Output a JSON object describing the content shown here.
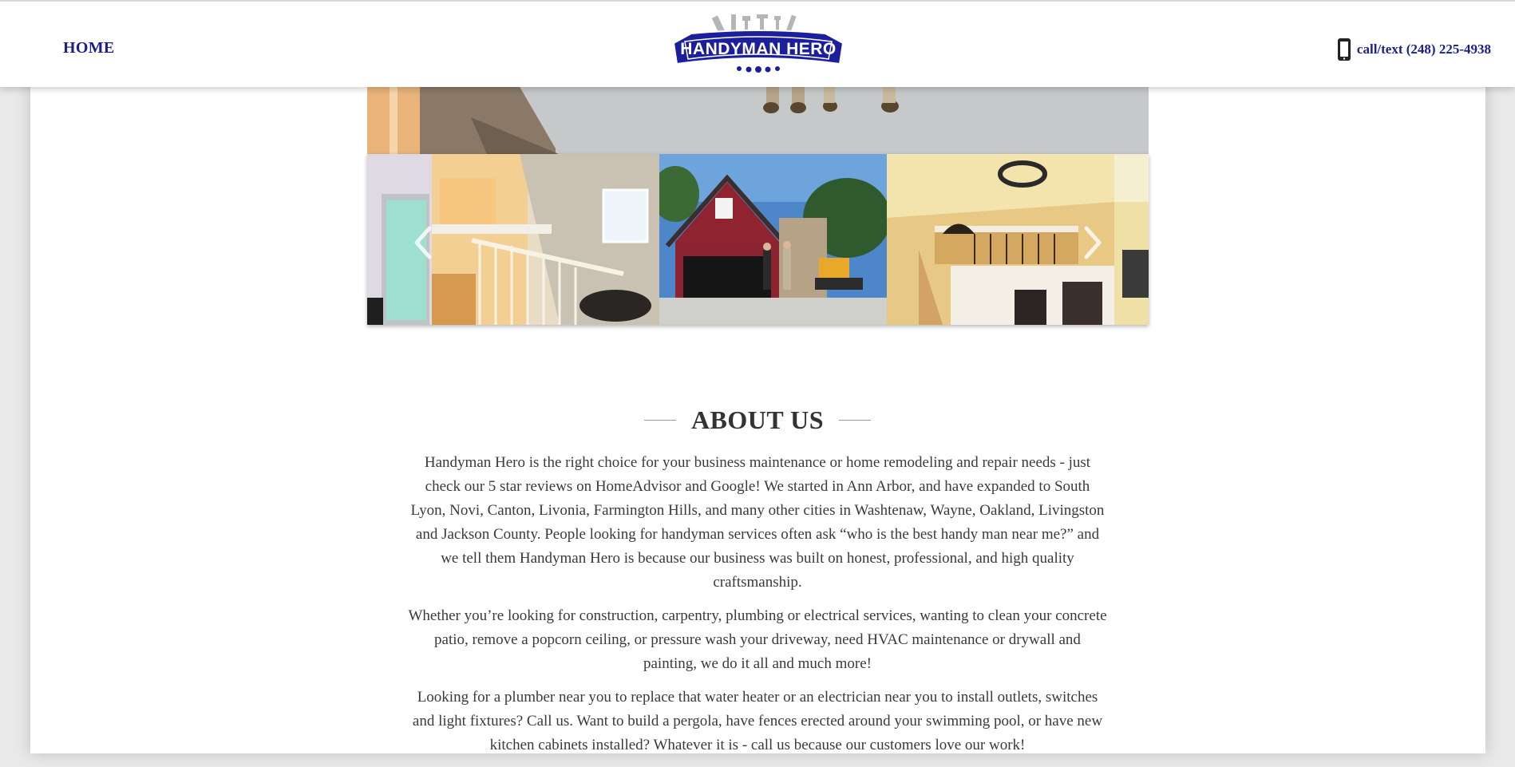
{
  "header": {
    "home_label": "HOME",
    "logo_text": "HANDYMAN HERO",
    "phone_label": "call/text (248) 225-4938"
  },
  "colors": {
    "brand_navy": "#1a1f8c",
    "logo_blue": "#1b1f9c",
    "text": "#3a3a3a"
  },
  "gallery": {
    "images": [
      "bathroom-mirror",
      "interior-staircase",
      "red-house-garage",
      "two-story-living-room",
      "yellow-interior"
    ],
    "prev_icon": "chevron-left-icon",
    "next_icon": "chevron-right-icon"
  },
  "about": {
    "heading": "ABOUT US",
    "paragraphs": [
      "Handyman Hero is the right choice for your business maintenance or home remodeling and repair needs - just check our 5 star reviews on HomeAdvisor and Google! We started in Ann Arbor, and have expanded to South Lyon, Novi, Canton, Livonia, Farmington Hills, and many other cities in Washtenaw, Wayne, Oakland, Livingston and Jackson County. People looking for handyman services often ask “who is the best handy man near me?” and we tell them Handyman Hero is because our business was built on honest, professional, and high quality craftsmanship.",
      "Whether you’re looking for construction, carpentry, plumbing or electrical services, wanting to clean your concrete patio, remove a popcorn ceiling, or pressure wash your driveway, need HVAC maintenance or drywall and painting, we do it all and much more!",
      "Looking for a plumber near you to replace that water heater or an electrician near you to install outlets, switches and light fixtures? Call us. Want to build a pergola, have fences erected around your swimming pool, or have new kitchen cabinets installed? Whatever it is - call us because our customers love our work!"
    ]
  }
}
